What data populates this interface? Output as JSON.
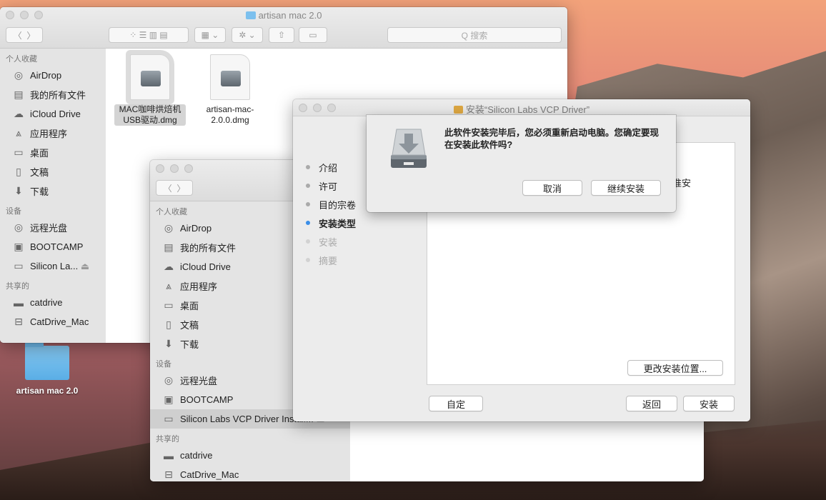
{
  "desktop": {
    "folder_label": "artisan mac 2.0"
  },
  "finder_back": {
    "title": "artisan mac 2.0",
    "search_placeholder": "Q 搜索",
    "sidebar": {
      "favorites_header": "个人收藏",
      "favorites": [
        "AirDrop",
        "我的所有文件",
        "iCloud Drive",
        "应用程序",
        "桌面",
        "文稿",
        "下载"
      ],
      "devices_header": "设备",
      "devices": [
        "远程光盘",
        "BOOTCAMP",
        "Silicon La..."
      ],
      "shared_header": "共享的",
      "shared": [
        "catdrive",
        "CatDrive_Mac"
      ]
    },
    "files": [
      {
        "name": "MAC咖啡烘焙机USB驱动.dmg"
      },
      {
        "name": "artisan-mac-2.0.0.dmg"
      }
    ]
  },
  "finder_front": {
    "sidebar": {
      "favorites_header": "个人收藏",
      "favorites": [
        "AirDrop",
        "我的所有文件",
        "iCloud Drive",
        "应用程序",
        "桌面",
        "文稿",
        "下载"
      ],
      "devices_header": "设备",
      "devices": [
        "远程光盘",
        "BOOTCAMP",
        "Silicon Labs VCP Driver Install..."
      ],
      "shared_header": "共享的",
      "shared": [
        "catdrive",
        "CatDrive_Mac"
      ]
    }
  },
  "installer": {
    "title": "安装“Silicon Labs VCP Driver”",
    "steps": [
      "介绍",
      "许可",
      "目的宗卷",
      "安装类型",
      "安装",
      "摘要"
    ],
    "active_step_index": 3,
    "pane_partial_text": "标准安",
    "change_location_button": "更改安装位置...",
    "customize_button": "自定",
    "back_button": "返回",
    "install_button": "安装"
  },
  "sheet": {
    "message": "此软件安装完毕后，您必须重新启动电脑。您确定要现在安装此软件吗?",
    "cancel_button": "取消",
    "continue_button": "继续安装"
  }
}
